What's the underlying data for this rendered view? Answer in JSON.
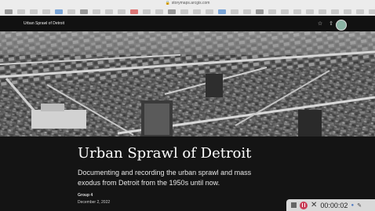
{
  "browser": {
    "url": "storymaps.arcgis.com"
  },
  "story": {
    "site_title": "Urban Sprawl of Detroit",
    "title": "Urban Sprawl of Detroit",
    "subtitle": "Documenting and recording the urban sprawl and mass exodus from Detroit from the 1950s until now.",
    "author": "Group 4",
    "date": "December 2, 2022"
  },
  "recorder": {
    "time": "00:00:02"
  },
  "icons": [
    "lock-icon",
    "star-icon",
    "share-icon",
    "more-icon",
    "avatar",
    "stop-icon",
    "pause-icon",
    "close-icon",
    "mic-icon",
    "pen-icon"
  ],
  "colors": {
    "page_bg": "#111111",
    "record_red": "#c93c56"
  }
}
